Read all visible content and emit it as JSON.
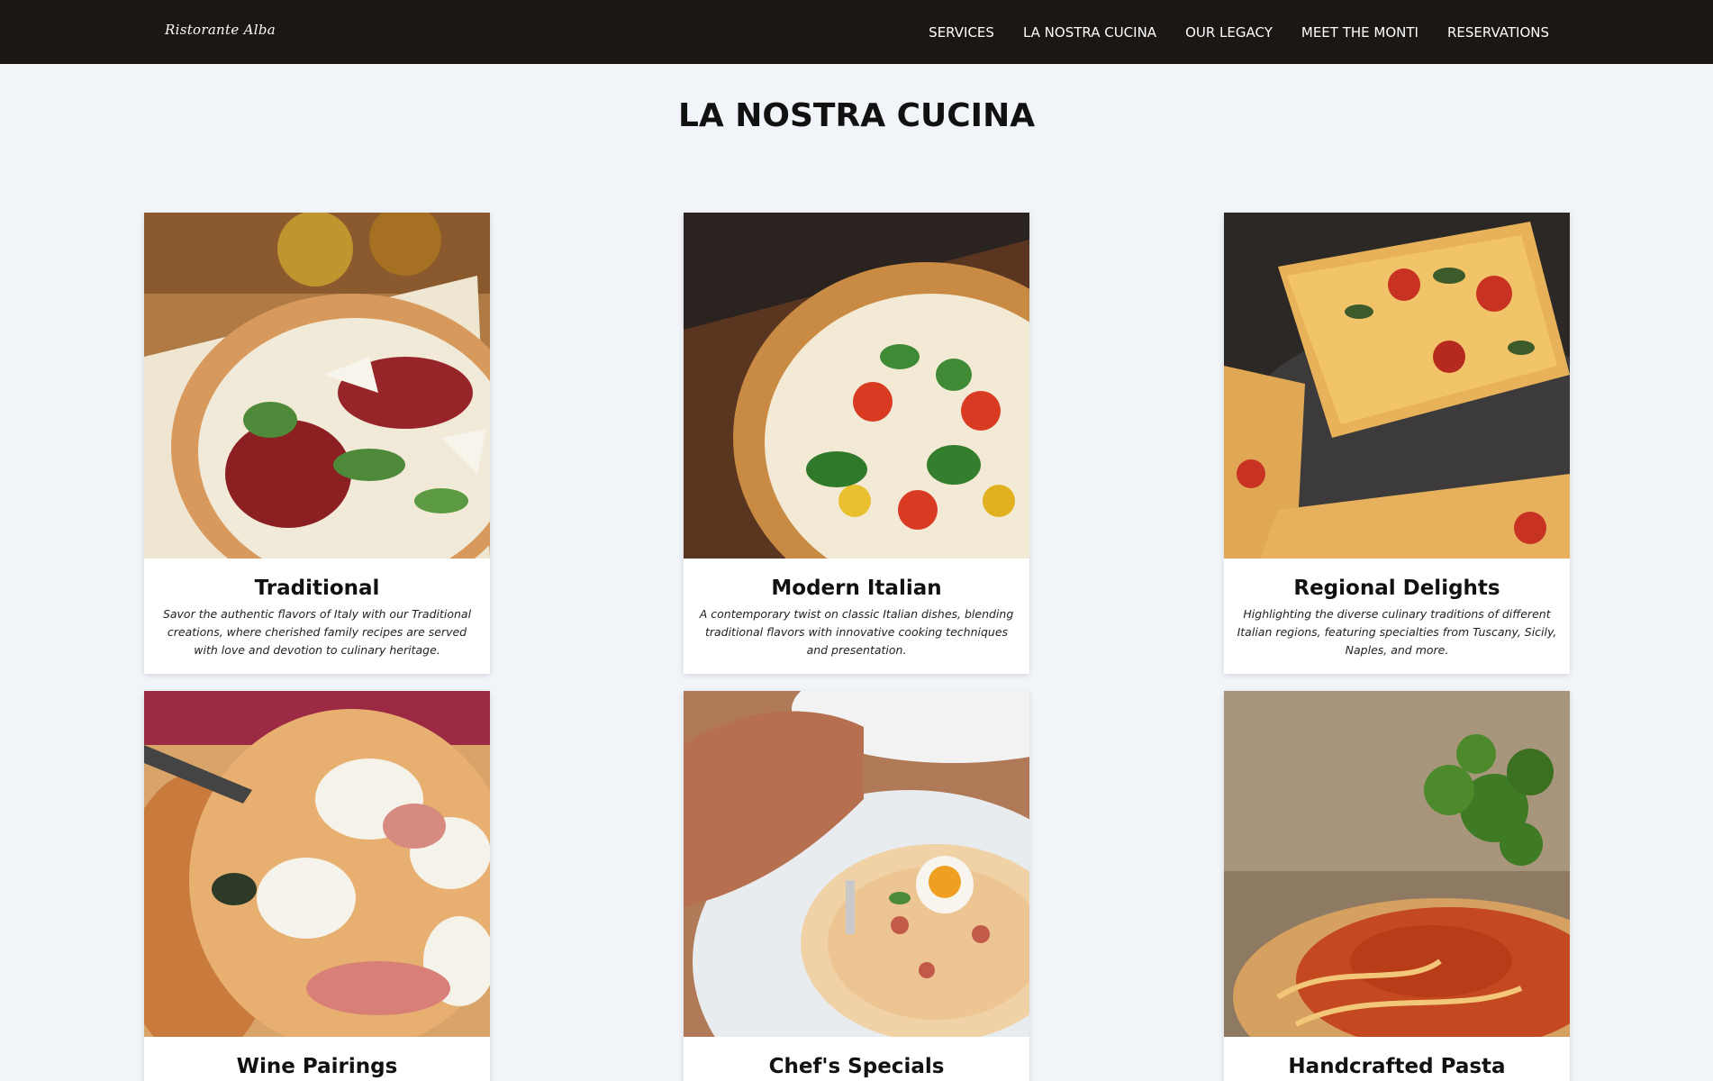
{
  "nav": {
    "logo": "Ristorante Alba",
    "links": [
      "SERVICES",
      "LA NOSTRA CUCINA",
      "OUR LEGACY",
      "MEET THE MONTI",
      "RESERVATIONS"
    ]
  },
  "main": {
    "title": "LA NOSTRA CUCINA",
    "cards": [
      {
        "title": "Traditional",
        "description": "Savor the authentic flavors of Italy with our Traditional creations, where cherished family recipes are served with love and devotion to culinary heritage."
      },
      {
        "title": "Modern Italian",
        "description": "A contemporary twist on classic Italian dishes, blending traditional flavors with innovative cooking techniques and presentation."
      },
      {
        "title": "Regional Delights",
        "description": "Highlighting the diverse culinary traditions of different Italian regions, featuring specialties from Tuscany, Sicily, Naples, and more."
      },
      {
        "title": "Wine Pairings",
        "description": ""
      },
      {
        "title": "Chef's Specials",
        "description": ""
      },
      {
        "title": "Handcrafted Pasta",
        "description": ""
      }
    ]
  },
  "colors": {
    "navbar": "#1b1714",
    "background": "#f1f4f8",
    "card": "#ffffff"
  }
}
